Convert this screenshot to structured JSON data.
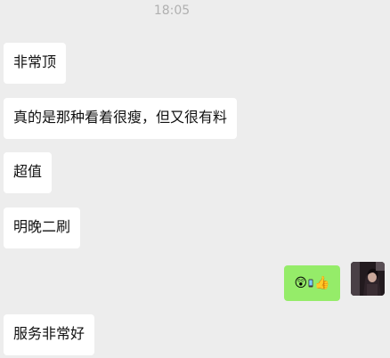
{
  "timestamp": "18:05",
  "messages": [
    {
      "text": "非常顶"
    },
    {
      "text": "真的是那种看着很瘦，但又很有料"
    },
    {
      "text": "超值"
    },
    {
      "text": "明晚二刷"
    },
    {
      "text": "服务非常好"
    }
  ],
  "self_message": {
    "emojis": [
      "😲",
      "👍"
    ]
  },
  "colors": {
    "background": "#ededed",
    "incoming_bubble": "#ffffff",
    "outgoing_bubble": "#95ec69",
    "timestamp": "#b0b0b0"
  }
}
